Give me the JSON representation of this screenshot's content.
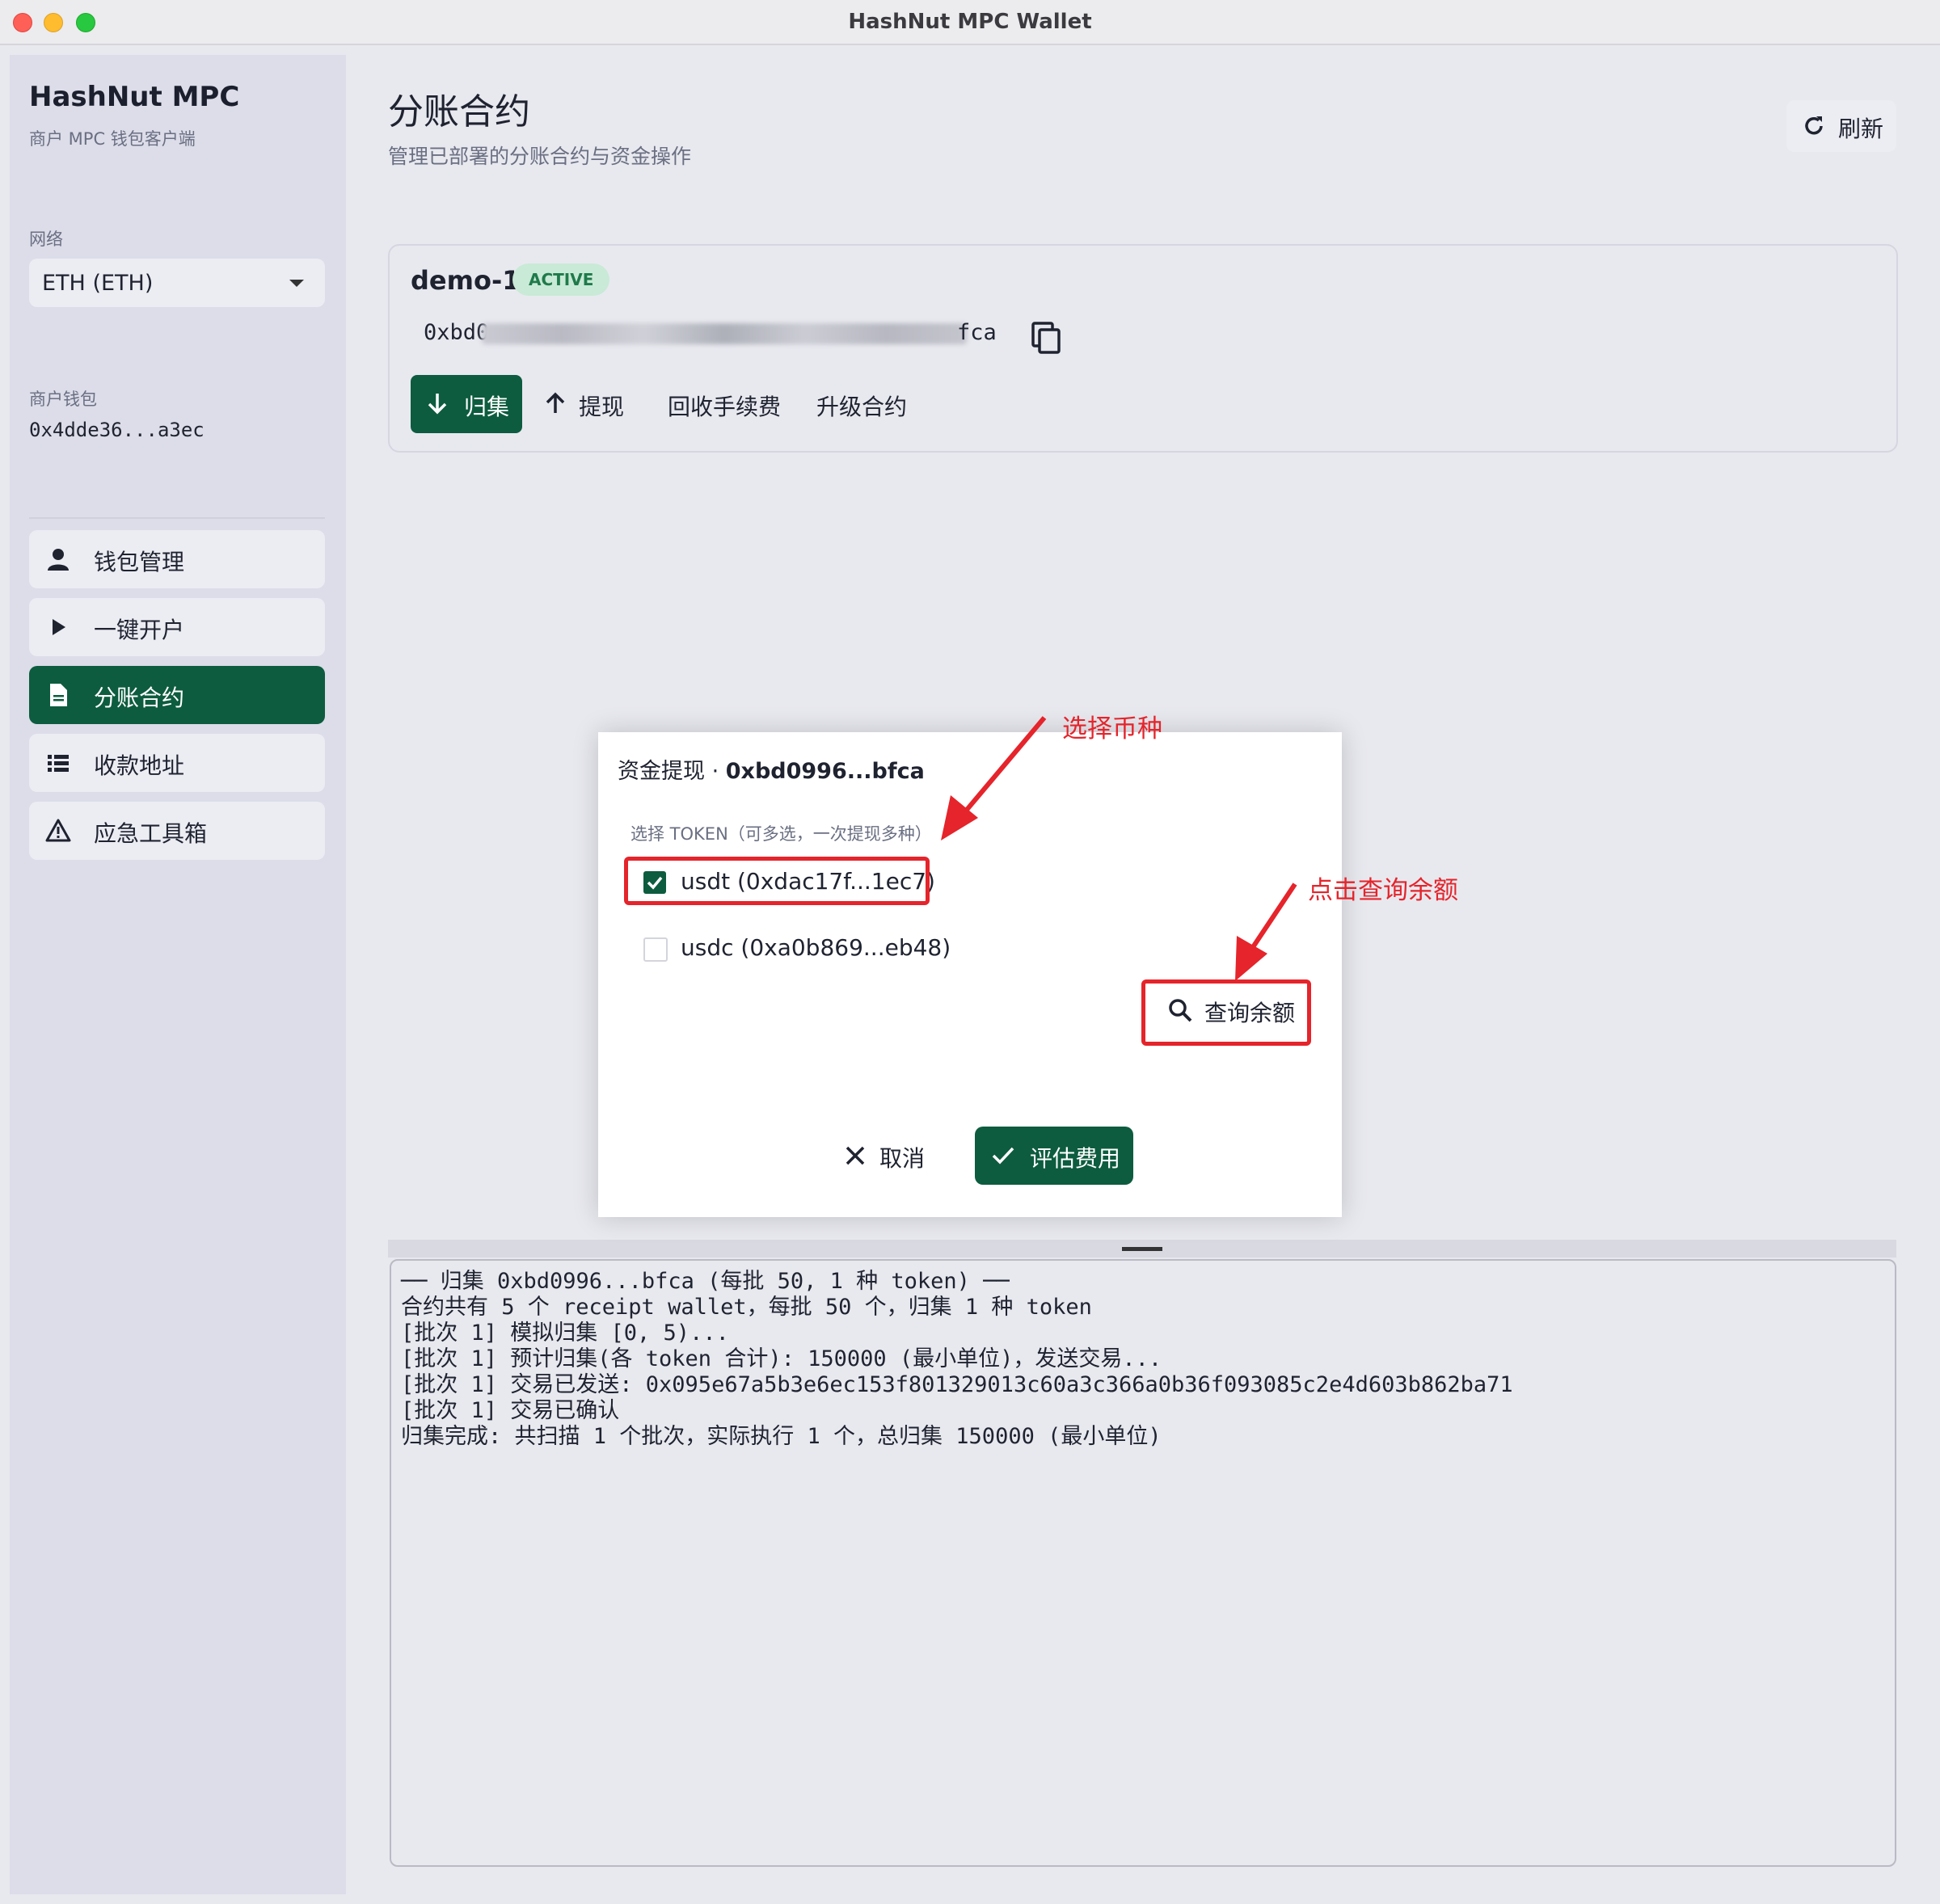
{
  "window": {
    "title": "HashNut MPC Wallet"
  },
  "sidebar": {
    "brand": "HashNut MPC",
    "brand_sub": "商户 MPC 钱包客户端",
    "network_label": "网络",
    "network_value": "ETH (ETH)",
    "merchant_wallet_label": "商户钱包",
    "merchant_wallet_addr": "0x4dde36...a3ec",
    "items": [
      {
        "label": "钱包管理",
        "icon": "user-icon",
        "active": false
      },
      {
        "label": "一键开户",
        "icon": "play-icon",
        "active": false
      },
      {
        "label": "分账合约",
        "icon": "document-icon",
        "active": true
      },
      {
        "label": "收款地址",
        "icon": "list-icon",
        "active": false
      },
      {
        "label": "应急工具箱",
        "icon": "warning-icon",
        "active": false
      }
    ]
  },
  "header": {
    "title": "分账合约",
    "subtitle": "管理已部署的分账合约与资金操作",
    "refresh_label": "刷新"
  },
  "contract": {
    "name": "demo-1",
    "status": "ACTIVE",
    "addr_start": "0xbd0",
    "addr_end": "fca",
    "actions": {
      "collect": "归集",
      "withdraw": "提现",
      "reclaim_fee": "回收手续费",
      "upgrade": "升级合约"
    }
  },
  "dialog": {
    "title_prefix": "资金提现 · ",
    "title_addr": "0xbd0996...bfca",
    "section_label": "选择 TOKEN（可多选，一次提现多种）",
    "tokens": [
      {
        "label": "usdt (0xdac17f...1ec7)",
        "checked": true
      },
      {
        "label": "usdc (0xa0b869...eb48)",
        "checked": false
      }
    ],
    "query_label": "查询余额",
    "cancel_label": "取消",
    "estimate_label": "评估费用"
  },
  "annotations": {
    "select_token": "选择币种",
    "click_query": "点击查询余额",
    "color": "#e5242b"
  },
  "log": {
    "lines": [
      "── 归集 0xbd0996...bfca (每批 50, 1 种 token) ──",
      "合约共有 5 个 receipt wallet，每批 50 个，归集 1 种 token",
      "[批次 1] 模拟归集 [0, 5)...",
      "[批次 1] 预计归集(各 token 合计): 150000 (最小单位)，发送交易...",
      "[批次 1] 交易已发送: 0x095e67a5b3e6ec153f801329013c60a3c366a0b36f093085c2e4d603b862ba71",
      "[批次 1] 交易已确认",
      "归集完成: 共扫描 1 个批次，实际执行 1 个，总归集 150000 (最小单位)"
    ]
  },
  "colors": {
    "accent": "#0d5c3f",
    "badge_bg": "#c9ead6",
    "badge_text": "#1f7a4a"
  }
}
